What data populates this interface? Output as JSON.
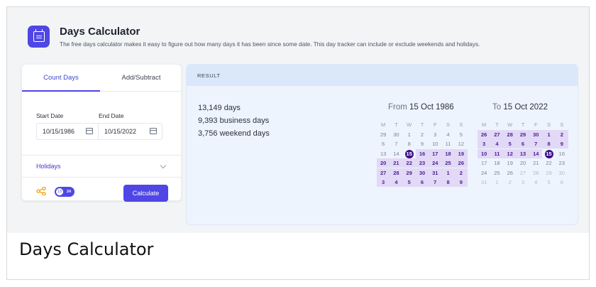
{
  "header": {
    "title": "Days Calculator",
    "subtitle": "The free days calculator makes it easy to figure out how many days it has been since some date. This day tracker can include or exclude weekends and holidays.",
    "logo_icon": "calendar-icon",
    "accent": "#4f46e5"
  },
  "form": {
    "tabs": [
      {
        "label": "Count Days"
      },
      {
        "label": "Add/Subtract"
      }
    ],
    "start_label": "Start Date",
    "end_label": "End Date",
    "start_value": "10/15/1986",
    "end_value": "10/15/2022",
    "holidays_label": "Holidays",
    "toggle": {
      "a": "13",
      "b": "24"
    },
    "calculate_label": "Calculate"
  },
  "result": {
    "label": "RESULT",
    "lines": [
      "13,149 days",
      "9,393 business days",
      "3,756 weekend days"
    ],
    "from": {
      "prefix": "From ",
      "date": "15 Oct 1986"
    },
    "to": {
      "prefix": "To ",
      "date": "15 Oct 2022"
    },
    "weekdays": [
      "M",
      "T",
      "W",
      "T",
      "F",
      "S",
      "S"
    ],
    "from_calendar": [
      [
        {
          "d": "29",
          "s": "n"
        },
        {
          "d": "30",
          "s": "n"
        },
        {
          "d": "1",
          "s": "n"
        },
        {
          "d": "2",
          "s": "n"
        },
        {
          "d": "3",
          "s": "n"
        },
        {
          "d": "4",
          "s": "n"
        },
        {
          "d": "5",
          "s": "n"
        }
      ],
      [
        {
          "d": "6",
          "s": "n"
        },
        {
          "d": "7",
          "s": "n"
        },
        {
          "d": "8",
          "s": "n"
        },
        {
          "d": "9",
          "s": "n"
        },
        {
          "d": "10",
          "s": "n"
        },
        {
          "d": "11",
          "s": "n"
        },
        {
          "d": "12",
          "s": "n"
        }
      ],
      [
        {
          "d": "13",
          "s": "n"
        },
        {
          "d": "14",
          "s": "n"
        },
        {
          "d": "15",
          "s": "mark"
        },
        {
          "d": "16",
          "s": "in"
        },
        {
          "d": "17",
          "s": "in"
        },
        {
          "d": "18",
          "s": "in"
        },
        {
          "d": "19",
          "s": "in"
        }
      ],
      [
        {
          "d": "20",
          "s": "in"
        },
        {
          "d": "21",
          "s": "in"
        },
        {
          "d": "22",
          "s": "in"
        },
        {
          "d": "23",
          "s": "in"
        },
        {
          "d": "24",
          "s": "in"
        },
        {
          "d": "25",
          "s": "in"
        },
        {
          "d": "26",
          "s": "in"
        }
      ],
      [
        {
          "d": "27",
          "s": "in"
        },
        {
          "d": "28",
          "s": "in"
        },
        {
          "d": "29",
          "s": "in"
        },
        {
          "d": "30",
          "s": "in"
        },
        {
          "d": "31",
          "s": "in"
        },
        {
          "d": "1",
          "s": "in"
        },
        {
          "d": "2",
          "s": "in"
        }
      ],
      [
        {
          "d": "3",
          "s": "in"
        },
        {
          "d": "4",
          "s": "in"
        },
        {
          "d": "5",
          "s": "in"
        },
        {
          "d": "6",
          "s": "in"
        },
        {
          "d": "7",
          "s": "in"
        },
        {
          "d": "8",
          "s": "in"
        },
        {
          "d": "9",
          "s": "in"
        }
      ]
    ],
    "to_calendar": [
      [
        {
          "d": "26",
          "s": "in"
        },
        {
          "d": "27",
          "s": "in"
        },
        {
          "d": "28",
          "s": "in"
        },
        {
          "d": "29",
          "s": "in"
        },
        {
          "d": "30",
          "s": "in"
        },
        {
          "d": "1",
          "s": "in"
        },
        {
          "d": "2",
          "s": "in"
        }
      ],
      [
        {
          "d": "3",
          "s": "in"
        },
        {
          "d": "4",
          "s": "in"
        },
        {
          "d": "5",
          "s": "in"
        },
        {
          "d": "6",
          "s": "in"
        },
        {
          "d": "7",
          "s": "in"
        },
        {
          "d": "8",
          "s": "in"
        },
        {
          "d": "9",
          "s": "in"
        }
      ],
      [
        {
          "d": "10",
          "s": "in"
        },
        {
          "d": "11",
          "s": "in"
        },
        {
          "d": "12",
          "s": "in"
        },
        {
          "d": "13",
          "s": "in"
        },
        {
          "d": "14",
          "s": "in"
        },
        {
          "d": "15",
          "s": "mark"
        },
        {
          "d": "16",
          "s": "n"
        }
      ],
      [
        {
          "d": "17",
          "s": "n"
        },
        {
          "d": "18",
          "s": "n"
        },
        {
          "d": "19",
          "s": "n"
        },
        {
          "d": "20",
          "s": "n"
        },
        {
          "d": "21",
          "s": "n"
        },
        {
          "d": "22",
          "s": "n"
        },
        {
          "d": "23",
          "s": "n"
        }
      ],
      [
        {
          "d": "24",
          "s": "n"
        },
        {
          "d": "25",
          "s": "n"
        },
        {
          "d": "26",
          "s": "n"
        },
        {
          "d": "27",
          "s": "dim"
        },
        {
          "d": "28",
          "s": "dim"
        },
        {
          "d": "29",
          "s": "dim"
        },
        {
          "d": "30",
          "s": "dim"
        }
      ],
      [
        {
          "d": "31",
          "s": "dim"
        },
        {
          "d": "1",
          "s": "dim"
        },
        {
          "d": "2",
          "s": "dim"
        },
        {
          "d": "3",
          "s": "dim"
        },
        {
          "d": "4",
          "s": "dim"
        },
        {
          "d": "5",
          "s": "dim"
        },
        {
          "d": "6",
          "s": "dim"
        }
      ]
    ]
  },
  "caption": "Days Calculator"
}
